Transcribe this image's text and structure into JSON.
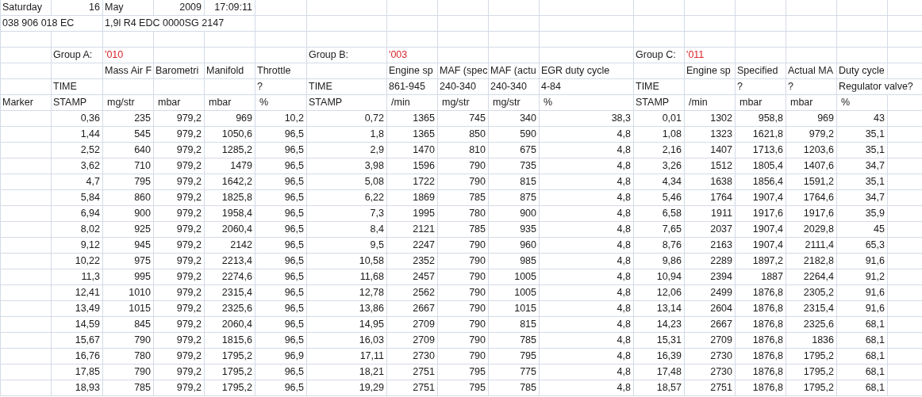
{
  "header": {
    "day": "Saturday",
    "day_number": "16",
    "month": "May",
    "year": "2009",
    "time": "17:09:11",
    "part_number": "038 906 018 EC",
    "engine": "1,9l R4 EDC 0000SG  2147"
  },
  "marker_label": "Marker",
  "groups": [
    {
      "label": "Group A:",
      "code": "'010",
      "time_label": "TIME",
      "stamp_label": "STAMP",
      "columns": [
        {
          "name": "Mass Air F",
          "unit": "mg/str"
        },
        {
          "name": "Barometri",
          "unit": "mbar"
        },
        {
          "name": "Manifold",
          "unit": "mbar"
        },
        {
          "name": "Throttle",
          "spec": "?",
          "unit": "%"
        }
      ]
    },
    {
      "label": "Group B:",
      "code": "'003",
      "time_label": "TIME",
      "stamp_label": "STAMP",
      "columns": [
        {
          "name": "Engine sp",
          "spec": "861-945",
          "unit": "/min"
        },
        {
          "name": "MAF (spec",
          "spec": "240-340",
          "unit": "mg/str"
        },
        {
          "name": "MAF (actu",
          "spec": "240-340",
          "unit": "mg/str"
        },
        {
          "name": "EGR duty cycle",
          "spec": "4-84",
          "unit": "%"
        }
      ]
    },
    {
      "label": "Group C:",
      "code": "'011",
      "time_label": "TIME",
      "stamp_label": "STAMP",
      "columns": [
        {
          "name": "Engine sp",
          "unit": "/min"
        },
        {
          "name": "Specified",
          "spec": "?",
          "unit": "mbar"
        },
        {
          "name": "Actual MA",
          "spec": "?",
          "unit": "mbar"
        },
        {
          "name": "Duty cycle",
          "spec": "Regulator valve?",
          "unit": "%"
        }
      ]
    }
  ],
  "rows": [
    [
      "0,36",
      "235",
      "979,2",
      "969",
      "10,2",
      "0,72",
      "1365",
      "745",
      "340",
      "38,3",
      "0,01",
      "1302",
      "958,8",
      "969",
      "43"
    ],
    [
      "1,44",
      "545",
      "979,2",
      "1050,6",
      "96,5",
      "1,8",
      "1365",
      "850",
      "590",
      "4,8",
      "1,08",
      "1323",
      "1621,8",
      "979,2",
      "35,1"
    ],
    [
      "2,52",
      "640",
      "979,2",
      "1285,2",
      "96,5",
      "2,9",
      "1470",
      "810",
      "675",
      "4,8",
      "2,16",
      "1407",
      "1713,6",
      "1203,6",
      "35,1"
    ],
    [
      "3,62",
      "710",
      "979,2",
      "1479",
      "96,5",
      "3,98",
      "1596",
      "790",
      "735",
      "4,8",
      "3,26",
      "1512",
      "1805,4",
      "1407,6",
      "34,7"
    ],
    [
      "4,7",
      "795",
      "979,2",
      "1642,2",
      "96,5",
      "5,08",
      "1722",
      "790",
      "815",
      "4,8",
      "4,34",
      "1638",
      "1856,4",
      "1591,2",
      "35,1"
    ],
    [
      "5,84",
      "860",
      "979,2",
      "1825,8",
      "96,5",
      "6,22",
      "1869",
      "785",
      "875",
      "4,8",
      "5,46",
      "1764",
      "1907,4",
      "1764,6",
      "34,7"
    ],
    [
      "6,94",
      "900",
      "979,2",
      "1958,4",
      "96,5",
      "7,3",
      "1995",
      "780",
      "900",
      "4,8",
      "6,58",
      "1911",
      "1917,6",
      "1917,6",
      "35,9"
    ],
    [
      "8,02",
      "925",
      "979,2",
      "2060,4",
      "96,5",
      "8,4",
      "2121",
      "785",
      "935",
      "4,8",
      "7,65",
      "2037",
      "1907,4",
      "2029,8",
      "45"
    ],
    [
      "9,12",
      "945",
      "979,2",
      "2142",
      "96,5",
      "9,5",
      "2247",
      "790",
      "960",
      "4,8",
      "8,76",
      "2163",
      "1907,4",
      "2111,4",
      "65,3"
    ],
    [
      "10,22",
      "975",
      "979,2",
      "2213,4",
      "96,5",
      "10,58",
      "2352",
      "790",
      "985",
      "4,8",
      "9,86",
      "2289",
      "1897,2",
      "2182,8",
      "91,6"
    ],
    [
      "11,3",
      "995",
      "979,2",
      "2274,6",
      "96,5",
      "11,68",
      "2457",
      "790",
      "1005",
      "4,8",
      "10,94",
      "2394",
      "1887",
      "2264,4",
      "91,2"
    ],
    [
      "12,41",
      "1010",
      "979,2",
      "2315,4",
      "96,5",
      "12,78",
      "2562",
      "790",
      "1005",
      "4,8",
      "12,06",
      "2499",
      "1876,8",
      "2305,2",
      "91,6"
    ],
    [
      "13,49",
      "1015",
      "979,2",
      "2325,6",
      "96,5",
      "13,86",
      "2667",
      "790",
      "1015",
      "4,8",
      "13,14",
      "2604",
      "1876,8",
      "2315,4",
      "91,6"
    ],
    [
      "14,59",
      "845",
      "979,2",
      "2060,4",
      "96,5",
      "14,95",
      "2709",
      "790",
      "815",
      "4,8",
      "14,23",
      "2667",
      "1876,8",
      "2325,6",
      "68,1"
    ],
    [
      "15,67",
      "790",
      "979,2",
      "1815,6",
      "96,5",
      "16,03",
      "2709",
      "790",
      "785",
      "4,8",
      "15,31",
      "2709",
      "1876,8",
      "1836",
      "68,1"
    ],
    [
      "16,76",
      "780",
      "979,2",
      "1795,2",
      "96,9",
      "17,11",
      "2730",
      "790",
      "795",
      "4,8",
      "16,39",
      "2730",
      "1876,8",
      "1795,2",
      "68,1"
    ],
    [
      "17,85",
      "790",
      "979,2",
      "1795,2",
      "96,5",
      "18,21",
      "2751",
      "795",
      "775",
      "4,8",
      "17,48",
      "2730",
      "1876,8",
      "1795,2",
      "68,1"
    ],
    [
      "18,93",
      "785",
      "979,2",
      "1795,2",
      "96,5",
      "19,29",
      "2751",
      "795",
      "785",
      "4,8",
      "18,57",
      "2751",
      "1876,8",
      "1795,2",
      "68,1"
    ]
  ]
}
